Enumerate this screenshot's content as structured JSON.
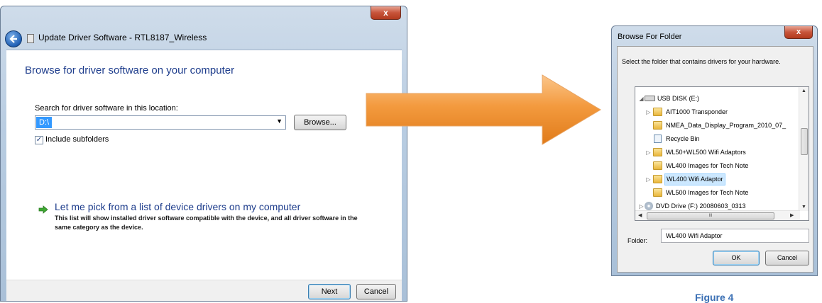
{
  "update_driver_window": {
    "title": "Update Driver Software - RTL8187_Wireless",
    "heading": "Browse for driver software on your computer",
    "search_label": "Search for driver software in this location:",
    "path_value": "D:\\",
    "browse_label": "Browse...",
    "include_subfolders_label": "Include subfolders",
    "include_subfolders_checked": true,
    "pick_link": "Let me pick from a list of device drivers on my computer",
    "pick_description": "This list will show installed driver software compatible with the device, and all driver software in the same category as the device.",
    "next_label": "Next",
    "cancel_label": "Cancel",
    "close_glyph": "x"
  },
  "browse_folder_window": {
    "title": "Browse For Folder",
    "instruction": "Select the folder that contains drivers for your hardware.",
    "tree_items": [
      {
        "label": "USB DISK (E:)",
        "icon": "usb-drive-icon",
        "expander": "◢",
        "level": 0
      },
      {
        "label": "AIT1000 Transponder",
        "icon": "folder-icon",
        "expander": "▷",
        "level": 1
      },
      {
        "label": "NMEA_Data_Display_Program_2010_07_",
        "icon": "folder-icon",
        "expander": "",
        "level": 1
      },
      {
        "label": "Recycle Bin",
        "icon": "recycle-bin-icon",
        "expander": "",
        "level": 1
      },
      {
        "label": "WL50+WL500 Wifi Adaptors",
        "icon": "folder-icon",
        "expander": "▷",
        "level": 1
      },
      {
        "label": "WL400 Images for Tech Note",
        "icon": "folder-icon",
        "expander": "",
        "level": 1
      },
      {
        "label": "WL400 Wifi Adaptor",
        "icon": "folder-icon",
        "expander": "▷",
        "level": 1,
        "selected": true
      },
      {
        "label": "WL500 Images for Tech Note",
        "icon": "folder-icon",
        "expander": "",
        "level": 1
      },
      {
        "label": "DVD Drive (F:) 20080603_0313",
        "icon": "dvd-drive-icon",
        "expander": "▷",
        "level": 0
      }
    ],
    "scroll_grip": "III",
    "folder_label": "Folder:",
    "folder_value": "WL400 Wifi Adaptor",
    "ok_label": "OK",
    "cancel_label": "Cancel",
    "close_glyph": "x"
  },
  "caption": "Figure 4"
}
